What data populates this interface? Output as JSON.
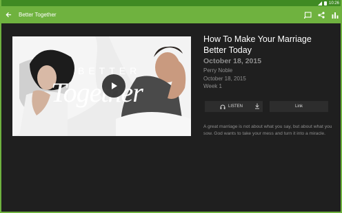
{
  "status": {
    "time": "10:26"
  },
  "toolbar": {
    "title": "Better Together",
    "icons": [
      "back-arrow-icon",
      "cast-icon",
      "share-icon",
      "stats-icon"
    ],
    "accent": "#6fb23f"
  },
  "video": {
    "watermark_top": "BETTER",
    "watermark_bottom": "Together",
    "icon": "play-icon"
  },
  "episode": {
    "title": "How To Make Your Marriage Better Today",
    "date_heading": "October 18, 2015",
    "speaker": "Perry Noble",
    "date": "October 18, 2015",
    "week": "Week 1",
    "description": "A great marriage is not about what you say, but about what you sow. God wants to take your mess and turn it into a miracle."
  },
  "buttons": {
    "listen_label": "LISTEN",
    "link_label": "Link"
  }
}
